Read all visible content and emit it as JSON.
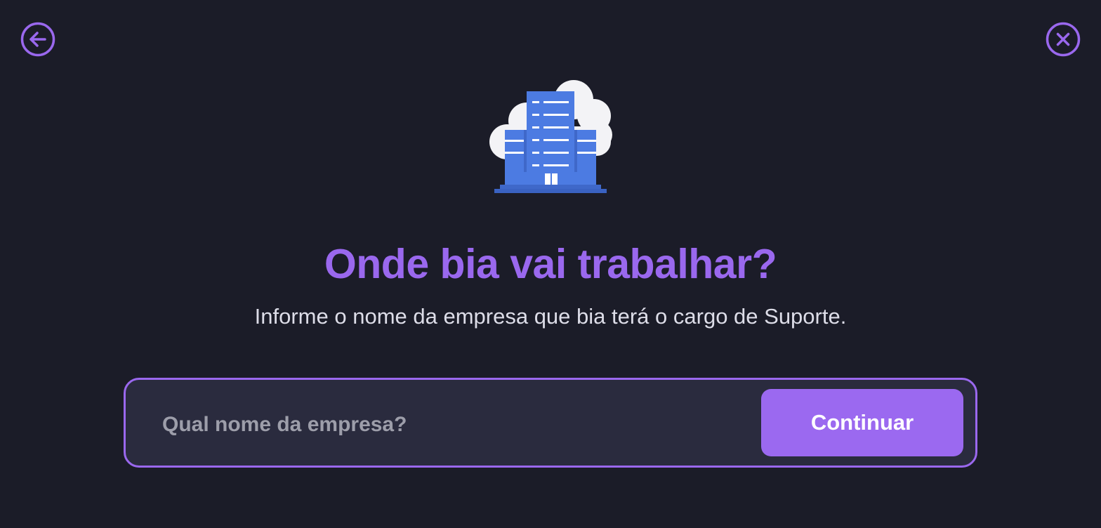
{
  "nav": {
    "back_icon": "arrow-left-circle-icon",
    "close_icon": "x-circle-icon"
  },
  "illustration": {
    "icon": "office-building-cloud-icon"
  },
  "heading": {
    "title": "Onde bia vai trabalhar?",
    "subtitle": "Informe o nome da empresa que bia terá o cargo de Suporte."
  },
  "form": {
    "company_input": {
      "value": "",
      "placeholder": "Qual nome da empresa?"
    },
    "continue_label": "Continuar"
  },
  "colors": {
    "background": "#1b1c28",
    "accent": "#9a68ee",
    "input_background": "#2a2b3e",
    "building_blue": "#4c7be2",
    "cloud": "#f3f3f6",
    "subtitle_text": "#dddde8",
    "placeholder_text": "#9d9eaa"
  }
}
